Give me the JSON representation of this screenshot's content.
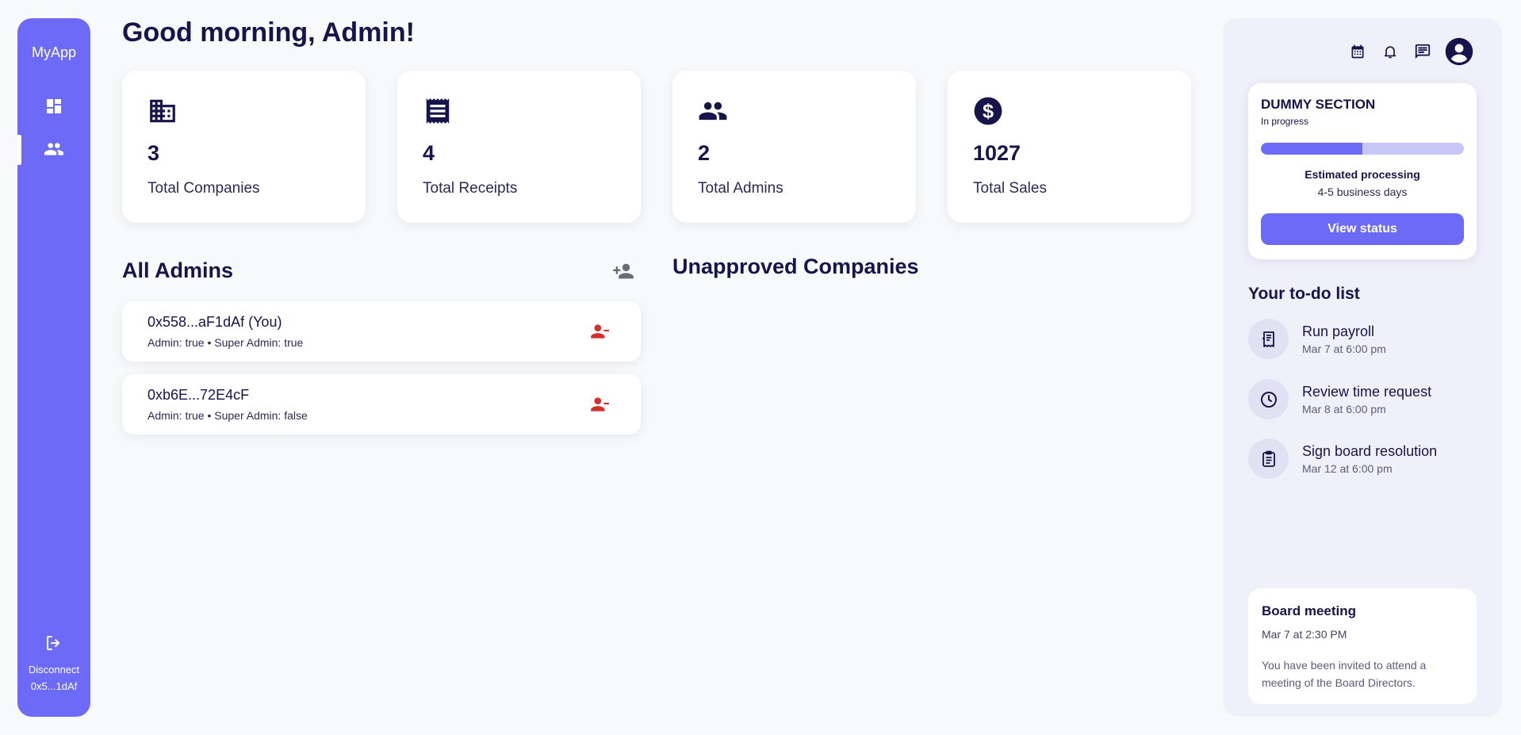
{
  "sidebar": {
    "brand": "MyApp",
    "nav": [
      {
        "icon": "dashboard-icon",
        "active": false
      },
      {
        "icon": "people-icon",
        "active": true
      }
    ],
    "disconnect_label": "Disconnect",
    "wallet_short": "0x5...1dAf"
  },
  "main": {
    "greeting": "Good morning, Admin!",
    "stats": [
      {
        "icon": "building-icon",
        "value": "3",
        "label": "Total Companies"
      },
      {
        "icon": "receipt-icon",
        "value": "4",
        "label": "Total Receipts"
      },
      {
        "icon": "people-icon",
        "value": "2",
        "label": "Total Admins"
      },
      {
        "icon": "dollar-icon",
        "value": "1027",
        "label": "Total Sales"
      }
    ],
    "admins_title": "All Admins",
    "admins": [
      {
        "address": "0x558...aF1dAf (You)",
        "meta": "Admin: true • Super Admin: true"
      },
      {
        "address": "0xb6E...72E4cF",
        "meta": "Admin: true • Super Admin: false"
      }
    ],
    "unapproved_title": "Unapproved Companies"
  },
  "right_panel": {
    "top_icons": [
      "calendar-icon",
      "bell-icon",
      "chat-icon",
      "account-icon"
    ],
    "dummy": {
      "title": "DUMMY SECTION",
      "status": "In progress",
      "progress_fraction": 0.5,
      "est_label": "Estimated processing",
      "est_value": "4-5 business days",
      "button_label": "View status"
    },
    "todo_title": "Your to-do list",
    "todos": [
      {
        "icon": "payroll-icon",
        "name": "Run payroll",
        "date": "Mar 7 at 6:00 pm"
      },
      {
        "icon": "clock-icon",
        "name": "Review time request",
        "date": "Mar 8 at 6:00 pm"
      },
      {
        "icon": "clipboard-icon",
        "name": "Sign board resolution",
        "date": "Mar 12 at 6:00 pm"
      }
    ],
    "meeting": {
      "title": "Board meeting",
      "time": "Mar 7 at 2:30 PM",
      "description": "You have been invited to attend a meeting of the Board Directors."
    }
  },
  "colors": {
    "accent": "#6c6af6",
    "accent_light": "#c8c6f6",
    "text_dark": "#16144a",
    "danger": "#d32f2f",
    "background": "#f8f9fb",
    "panel": "#f0f0fb"
  }
}
